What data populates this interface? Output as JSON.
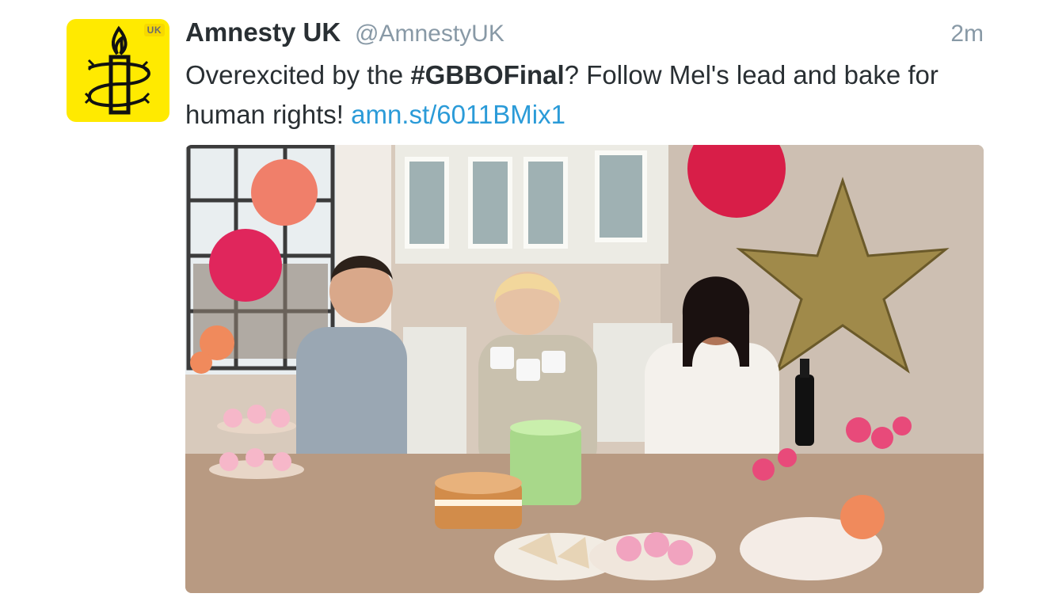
{
  "tweet": {
    "avatar": {
      "badge": "UK",
      "icon": "amnesty-candle-icon",
      "background_color": "#ffea00"
    },
    "display_name": "Amnesty UK",
    "handle": "@AmnestyUK",
    "timestamp": "2m",
    "text": {
      "part1": "Overexcited by the ",
      "hashtag": "#GBBOFinal",
      "part2": "? Follow Mel's lead and bake for human rights! ",
      "link": "amn.st/6011BMix1"
    },
    "colors": {
      "link": "#2b9bd8",
      "secondary_text": "#8899a6",
      "primary_text": "#292f33"
    },
    "media": {
      "type": "photo",
      "subject": "three people toasting with teacups at a table full of cakes"
    }
  }
}
